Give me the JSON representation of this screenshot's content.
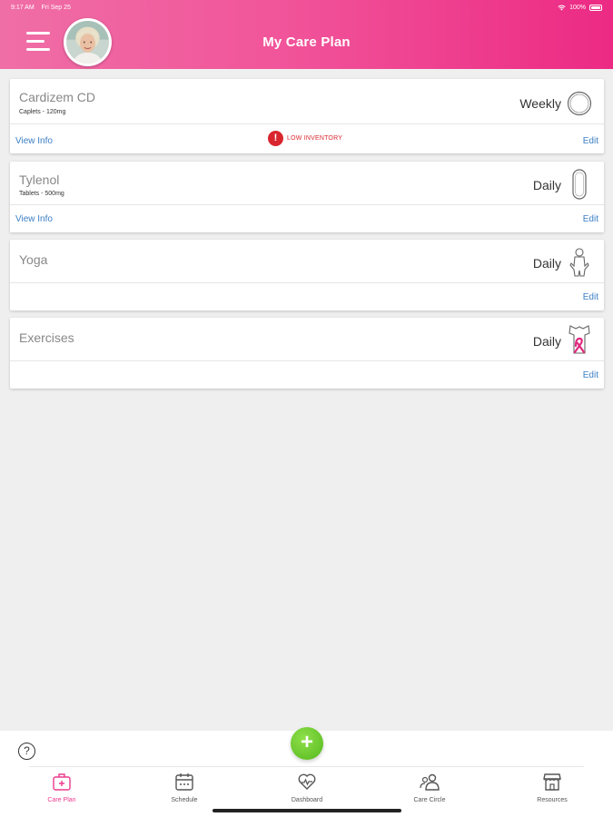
{
  "status_bar": {
    "time": "9:17 AM",
    "date": "Fri Sep 25",
    "battery": "100%"
  },
  "header": {
    "title": "My Care Plan",
    "accent": "#ec2a84"
  },
  "care_items": [
    {
      "name": "Cardizem CD",
      "detail": "Caplets - 120mg",
      "frequency": "Weekly",
      "icon": "round-pill-icon",
      "view_info": "View Info",
      "alert": "LOW INVENTORY",
      "edit": "Edit"
    },
    {
      "name": "Tylenol",
      "detail": "Tablets - 500mg",
      "frequency": "Daily",
      "icon": "capsule-pill-icon",
      "view_info": "View Info",
      "edit": "Edit"
    },
    {
      "name": "Yoga",
      "frequency": "Daily",
      "icon": "yoga-figure-icon",
      "edit": "Edit"
    },
    {
      "name": "Exercises",
      "frequency": "Daily",
      "icon": "exercise-ribbon-icon",
      "edit": "Edit"
    }
  ],
  "fab": {
    "symbol": "+",
    "color": "#5cbf24"
  },
  "help": {
    "symbol": "?"
  },
  "tabs": [
    {
      "label": "Care Plan",
      "icon": "medkit-icon",
      "active": true
    },
    {
      "label": "Schedule",
      "icon": "calendar-icon",
      "active": false
    },
    {
      "label": "Dashboard",
      "icon": "heart-pulse-icon",
      "active": false
    },
    {
      "label": "Care Circle",
      "icon": "people-icon",
      "active": false
    },
    {
      "label": "Resources",
      "icon": "store-icon",
      "active": false
    }
  ]
}
